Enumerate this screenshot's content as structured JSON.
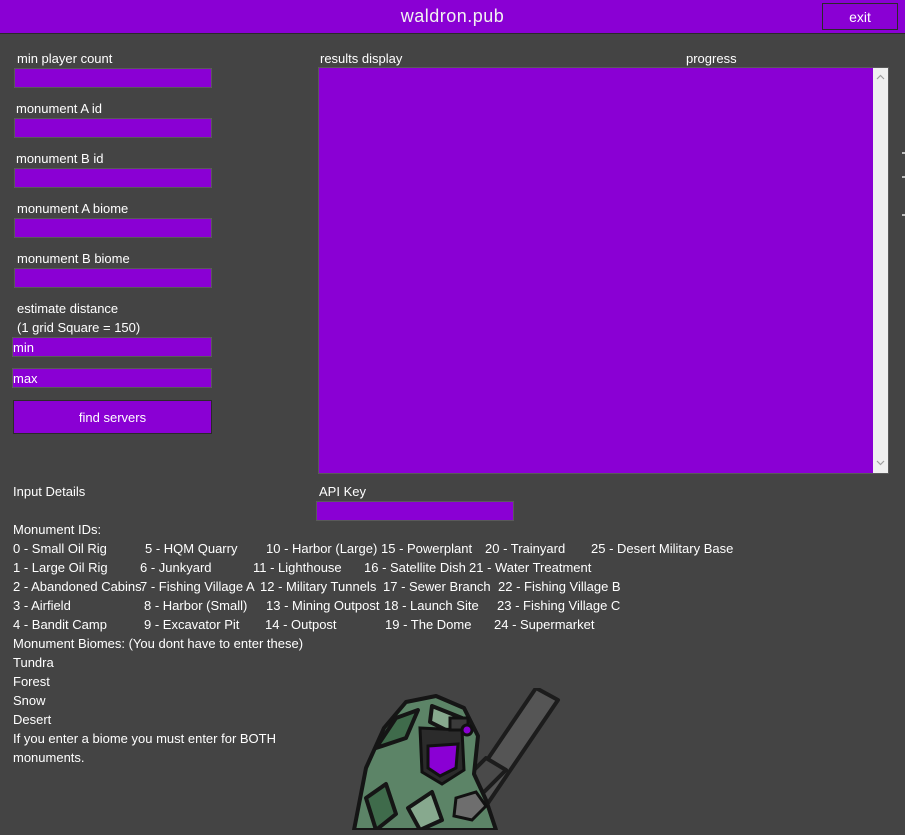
{
  "window": {
    "title": "waldron.pub",
    "exit_label": "exit"
  },
  "form": {
    "min_player_count_label": "min player count",
    "monument_a_id_label": "monument A id",
    "monument_b_id_label": "monument B id",
    "monument_a_biome_label": "monument A biome",
    "monument_b_biome_label": "monument B biome",
    "estimate_distance_label": "estimate distance",
    "grid_note": "(1 grid Square = 150)",
    "min_value": "min",
    "max_value": "max",
    "find_servers_label": "find servers"
  },
  "results": {
    "label": "results display",
    "progress_label": "progress"
  },
  "api": {
    "label": "API Key"
  },
  "details": {
    "input_details": "Input Details",
    "monument_ids_heading": "Monument IDs:",
    "monument_ids": [
      "0 - Small Oil Rig",
      "1 - Large Oil Rig",
      "2 - Abandoned Cabins",
      "3 - Airfield",
      "4 - Bandit Camp",
      "5 - HQM Quarry",
      "6 - Junkyard",
      "7 - Fishing Village A",
      "8 - Harbor (Small)",
      "9 - Excavator Pit",
      "10 - Harbor (Large)",
      "11 - Lighthouse",
      "12 - Military Tunnels",
      "13 - Mining Outpost",
      "14 - Outpost",
      "15 - Powerplant",
      "16 - Satellite Dish",
      "17 - Sewer Branch",
      "18 - Launch Site",
      "19 - The Dome",
      "20 - Trainyard",
      "21 - Water Treatment",
      "22 - Fishing Village B",
      "23 - Fishing Village C",
      "24 - Supermarket",
      "25 - Desert Military Base"
    ],
    "biomes_heading": "Monument Biomes: (You dont have to enter these)",
    "biomes": [
      "Tundra",
      "Forest",
      "Snow",
      "Desert"
    ],
    "biome_note_1": "If you enter a biome you must enter for BOTH",
    "biome_note_2": "monuments."
  },
  "colors": {
    "accent": "#8a00d4",
    "background": "#444444"
  },
  "icons": {
    "mascot": "soldier-mascot",
    "scroll_up": "chevron-up-icon",
    "scroll_down": "chevron-down-icon"
  }
}
